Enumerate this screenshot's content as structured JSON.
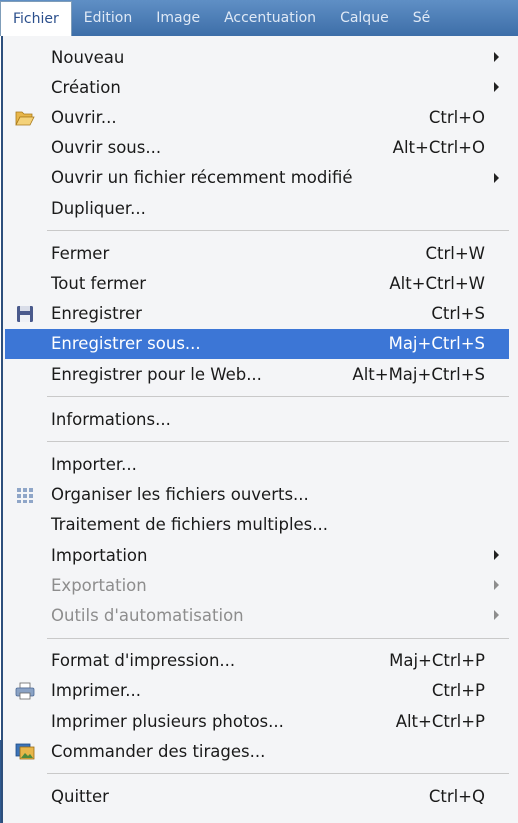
{
  "menubar": {
    "items": [
      {
        "label": "Fichier",
        "active": true
      },
      {
        "label": "Edition",
        "active": false
      },
      {
        "label": "Image",
        "active": false
      },
      {
        "label": "Accentuation",
        "active": false
      },
      {
        "label": "Calque",
        "active": false
      },
      {
        "label": "Sé",
        "active": false
      }
    ]
  },
  "menu": {
    "groups": [
      [
        {
          "label": "Nouveau",
          "submenu": true
        },
        {
          "label": "Création",
          "submenu": true
        },
        {
          "label": "Ouvrir...",
          "shortcut": "Ctrl+O",
          "icon": "folder-open-icon"
        },
        {
          "label": "Ouvrir sous...",
          "shortcut": "Alt+Ctrl+O"
        },
        {
          "label": "Ouvrir un fichier récemment modifié",
          "submenu": true
        },
        {
          "label": "Dupliquer..."
        }
      ],
      [
        {
          "label": "Fermer",
          "shortcut": "Ctrl+W"
        },
        {
          "label": "Tout fermer",
          "shortcut": "Alt+Ctrl+W"
        },
        {
          "label": "Enregistrer",
          "shortcut": "Ctrl+S",
          "icon": "floppy-disk-icon"
        },
        {
          "label": "Enregistrer sous...",
          "shortcut": "Maj+Ctrl+S",
          "highlighted": true
        },
        {
          "label": "Enregistrer pour le Web...",
          "shortcut": "Alt+Maj+Ctrl+S"
        }
      ],
      [
        {
          "label": "Informations..."
        }
      ],
      [
        {
          "label": "Importer..."
        },
        {
          "label": "Organiser les fichiers ouverts...",
          "icon": "grid-icon"
        },
        {
          "label": "Traitement de fichiers multiples..."
        },
        {
          "label": "Importation",
          "submenu": true
        },
        {
          "label": "Exportation",
          "submenu": true,
          "disabled": true
        },
        {
          "label": "Outils d'automatisation",
          "submenu": true,
          "disabled": true
        }
      ],
      [
        {
          "label": "Format d'impression...",
          "shortcut": "Maj+Ctrl+P"
        },
        {
          "label": "Imprimer...",
          "shortcut": "Ctrl+P",
          "icon": "printer-icon"
        },
        {
          "label": "Imprimer plusieurs photos...",
          "shortcut": "Alt+Ctrl+P"
        },
        {
          "label": "Commander des tirages...",
          "icon": "photo-prints-icon"
        }
      ],
      [
        {
          "label": "Quitter",
          "shortcut": "Ctrl+Q"
        }
      ]
    ],
    "colors": {
      "highlight": "#3c76d6",
      "disabled": "#8d8d8d",
      "bar": "#4a7bb6"
    }
  }
}
